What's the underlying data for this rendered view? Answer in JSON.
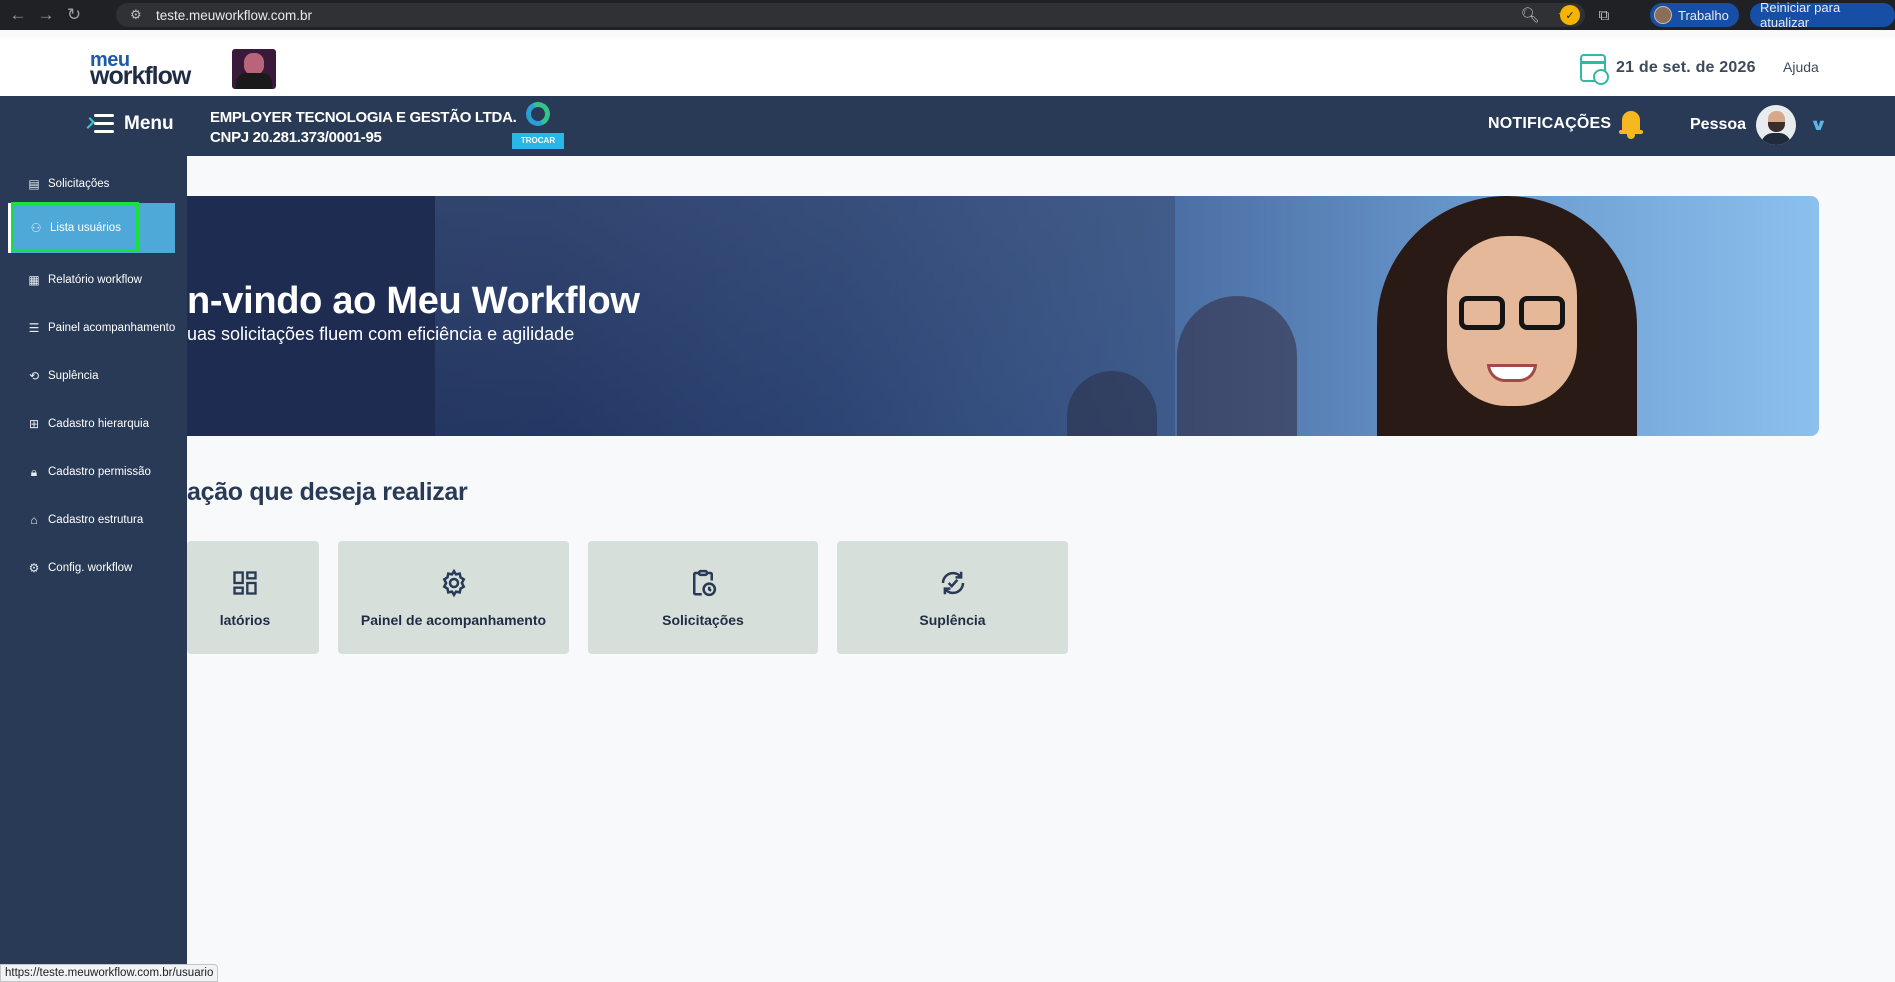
{
  "browser": {
    "url": "teste.meuworkflow.com.br",
    "profile_label": "Trabalho",
    "update_label": "Reiniciar para atualizar",
    "status_url": "https://teste.meuworkflow.com.br/usuario"
  },
  "header": {
    "logo_top": "meu",
    "logo_bottom": "workflow",
    "date": "21 de set. de 2026",
    "help": "Ajuda"
  },
  "navbar": {
    "menu_label": "Menu",
    "company_name": "EMPLOYER TECNOLOGIA E GESTÃO LTDA.",
    "company_cnpj": "CNPJ 20.281.373/0001-95",
    "switch_label": "TROCAR",
    "notifications_label": "NOTIFICAÇÕES",
    "user_name": "Pessoa"
  },
  "sidebar": {
    "items": [
      {
        "label": "Solicitações",
        "icon": "clipboard-icon"
      },
      {
        "label": "Lista usuários",
        "icon": "users-icon"
      },
      {
        "label": "Relatório workflow",
        "icon": "grid-icon"
      },
      {
        "label": "Painel acompanhamento",
        "icon": "list-icon"
      },
      {
        "label": "Suplência",
        "icon": "refresh-icon"
      },
      {
        "label": "Cadastro hierarquia",
        "icon": "plus-square-icon"
      },
      {
        "label": "Cadastro permissão",
        "icon": "lock-icon"
      },
      {
        "label": "Cadastro estrutura",
        "icon": "building-icon"
      },
      {
        "label": "Config. workflow",
        "icon": "gear-icon"
      }
    ],
    "active_index": 1
  },
  "main": {
    "hero_title": "n-vindo ao Meu Workflow",
    "hero_subtitle": "uas solicitações fluem com eficiência e agilidade",
    "section_title": "ação que deseja realizar",
    "cards": [
      {
        "label": "latórios",
        "icon": "dashboard-icon"
      },
      {
        "label": "Painel de acompanhamento",
        "icon": "gear-icon"
      },
      {
        "label": "Solicitações",
        "icon": "clipboard-clock-icon"
      },
      {
        "label": "Suplência",
        "icon": "refresh-check-icon"
      }
    ]
  },
  "colors": {
    "nav_bg": "#283a55",
    "active_item": "#4ea8d8",
    "card_bg": "#d6dfd9",
    "highlight": "#19e03b",
    "accent_teal": "#2fb9a6"
  }
}
